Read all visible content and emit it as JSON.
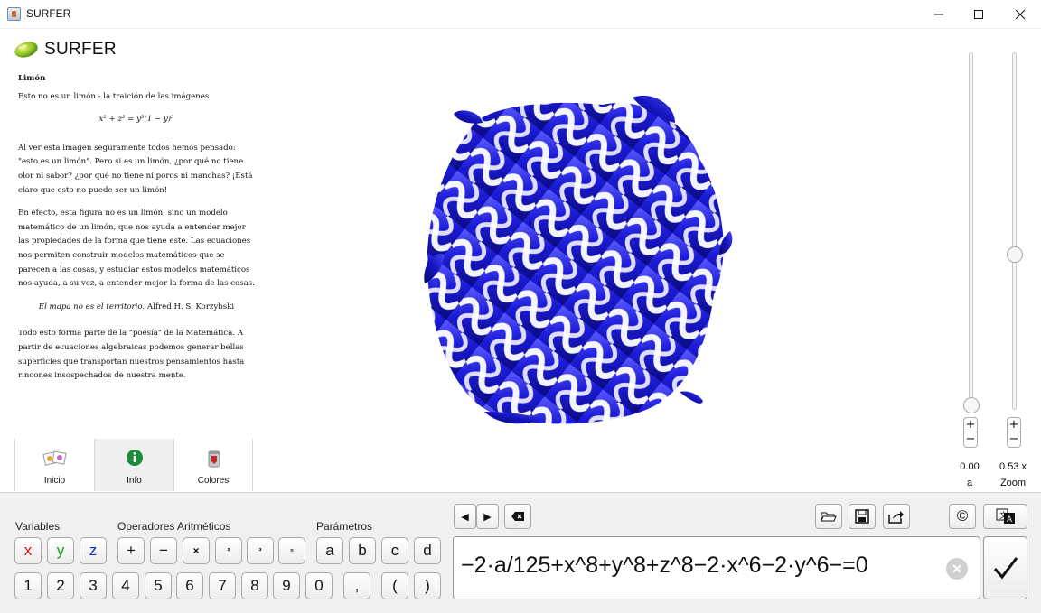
{
  "window": {
    "title": "SURFER",
    "minimize": "—",
    "maximize": "☐",
    "close": "✕"
  },
  "logo": {
    "text": "SURFER"
  },
  "doc": {
    "heading": "Limón",
    "subtitle": "Esto no es un limón - la traición de las imágenes",
    "formula": "x² + z² = y³(1 − y)³",
    "para1": "Al ver esta imagen seguramente todos hemos pensado: \"esto es un limón\". Pero si es un limón, ¿por qué no tiene olor ni sabor? ¿por qué no tiene ni poros ni manchas? ¡Está claro que esto no puede ser un limón!",
    "para2": "En efecto, esta figura no es un limón, sino un modelo matemático de un limón, que nos ayuda a entender mejor las propiedades de la forma que tiene este. Las ecuaciones nos permiten construir modelos matemáticos que se parecen a las cosas, y estudiar estos modelos matemáticos nos ayuda, a su vez, a entender mejor la forma de las cosas.",
    "quote_italic": "El mapa no es el territorio.",
    "quote_author": " Alfred H. S. Korzybski",
    "para3": "Todo esto forma parte de la \"poesía\" de la Matemática. A partir de ecuaciones algebraicas podemos generar bellas superficies que transportan nuestros pensamientos hasta rincones insospechados de nuestra mente."
  },
  "tabs": [
    {
      "label": "Inicio",
      "icon": "gallery-icon",
      "active": false
    },
    {
      "label": "Info",
      "icon": "info-icon",
      "active": true
    },
    {
      "label": "Colores",
      "icon": "paint-bucket-icon",
      "active": false
    }
  ],
  "sliders": {
    "a": {
      "value": "0.00",
      "name": "a",
      "level": 0.0
    },
    "zoom": {
      "value": "0.53 x",
      "name": "Zoom",
      "level": 0.43
    },
    "plus": "+",
    "minus": "−"
  },
  "surface": {
    "color": "#1a1ad0"
  },
  "keyboard": {
    "variables_label": "Variables",
    "operators_label": "Operadores Aritméticos",
    "parameters_label": "Parámetros",
    "variables": [
      "x",
      "y",
      "z"
    ],
    "operators": [
      "+",
      "−",
      "×",
      "²",
      "³",
      "ⁿ"
    ],
    "parameters": [
      "a",
      "b",
      "c",
      "d"
    ],
    "digits": [
      "1",
      "2",
      "3",
      "4",
      "5",
      "6",
      "7",
      "8",
      "9",
      "0"
    ],
    "comma": ",",
    "paren_open": "(",
    "paren_close": ")"
  },
  "equation": {
    "text": "−2·a/125+x^8+y^8+z^8−2·x^6−2·y^6−=0"
  },
  "toolbar": {
    "cursor_left": "◀",
    "cursor_right": "▶",
    "backspace": "backspace-icon",
    "open": "folder-open-icon",
    "save": "save-icon",
    "export": "export-icon",
    "copyright": "©",
    "language": "language-icon"
  }
}
